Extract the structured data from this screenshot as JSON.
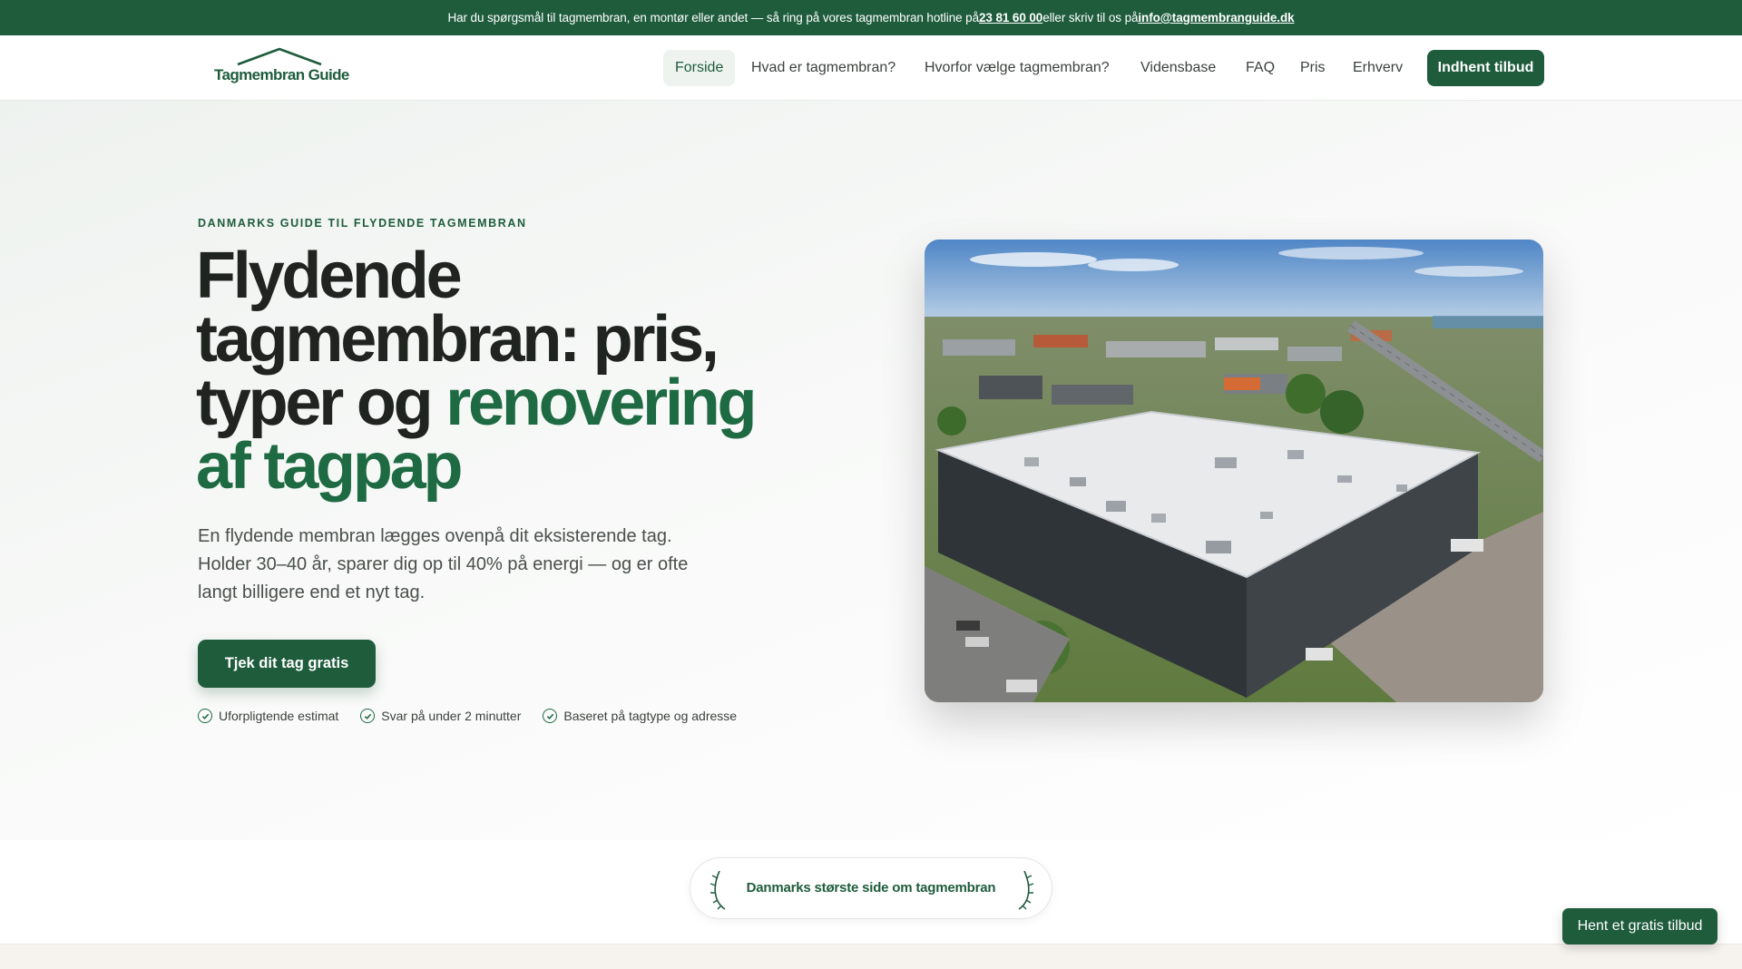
{
  "topbar": {
    "text_before": "Har du spørgsmål til tagmembran, en montør eller andet — så ring på vores tagmembran hotline på ",
    "phone": "23 81 60 00",
    "text_middle": " eller skriv til os på ",
    "email": "info@tagmembranguide.dk"
  },
  "header": {
    "logo_text": "Tagmembran Guide",
    "nav": [
      {
        "label": "Forside"
      },
      {
        "label": "Hvad er tagmembran?"
      },
      {
        "label": "Hvorfor vælge tagmembran?"
      },
      {
        "label": "Vidensbase"
      },
      {
        "label": "FAQ"
      },
      {
        "label": "Pris"
      },
      {
        "label": "Erhverv"
      }
    ],
    "cta_label": "Indhent tilbud"
  },
  "hero": {
    "eyebrow": "DANMARKS GUIDE TIL FLYDENDE TAGMEMBRAN",
    "headline_dark": "Flydende tagmembran: pris, typer og ",
    "headline_green": "renovering af tagpap",
    "lead": "En flydende membran lægges ovenpå dit eksisterende tag. Holder 30–40 år, sparer dig op til 40% på energi — og er ofte langt billigere end et nyt tag.",
    "cta_label": "Tjek dit tag gratis",
    "checks": [
      {
        "label": "Uforpligtende estimat"
      },
      {
        "label": "Svar på under 2 minutter"
      },
      {
        "label": "Baseret på tagtype og adresse"
      }
    ]
  },
  "badge": {
    "label": "Danmarks største side om tagmembran"
  },
  "floating_cta": {
    "label": "Hent et gratis tilbud"
  },
  "colors": {
    "brand_green": "#1e5c3c",
    "accent_green": "#1e6a43"
  }
}
